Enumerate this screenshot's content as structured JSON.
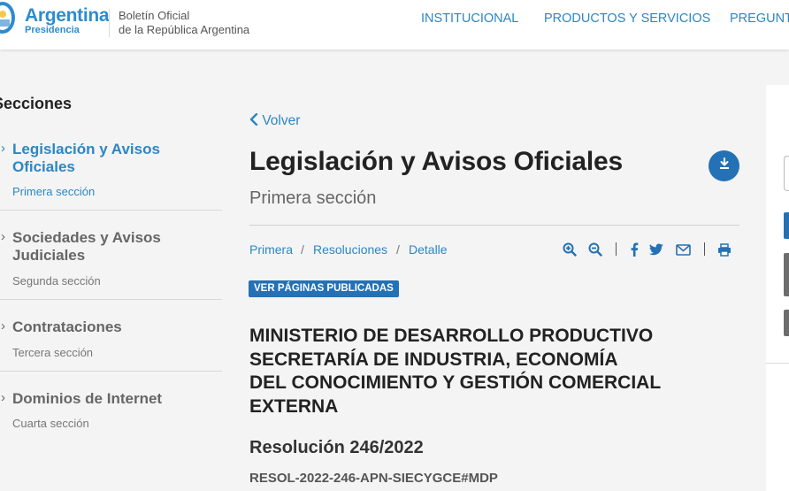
{
  "header": {
    "brand": {
      "name": "Argentina",
      "sub": "Presidencia"
    },
    "boletin": {
      "line1": "Boletín Oficial",
      "line2": "de la República Argentina"
    },
    "nav": [
      "INSTITUCIONAL",
      "PRODUCTOS Y SERVICIOS",
      "PREGUNT"
    ]
  },
  "sidebar": {
    "title": "Secciones",
    "sections": [
      {
        "label": "Legislación y Avisos Oficiales",
        "sub": "Primera sección",
        "active": true
      },
      {
        "label": "Sociedades y Avisos Judiciales",
        "sub": "Segunda sección",
        "active": false
      },
      {
        "label": "Contrataciones",
        "sub": "Tercera sección",
        "active": false
      },
      {
        "label": "Dominios de Internet",
        "sub": "Cuarta sección",
        "active": false
      }
    ]
  },
  "main": {
    "back_label": "Volver",
    "title": "Legislación y Avisos Oficiales",
    "subtitle": "Primera sección",
    "breadcrumb": [
      "Primera",
      "Resoluciones",
      "Detalle"
    ],
    "badge": "VER PÁGINAS PUBLICADAS",
    "organization": [
      "MINISTERIO DE DESARROLLO PRODUCTIVO",
      "SECRETARÍA DE INDUSTRIA, ECONOMÍA",
      "DEL CONOCIMIENTO Y GESTIÓN COMERCIAL",
      "EXTERNA"
    ],
    "resolution_title": "Resolución 246/2022",
    "resolution_code": "RESOL-2022-246-APN-SIECYGCE#MDP"
  },
  "icons": {
    "download": "download-icon",
    "zoom_in": "zoom-in-icon",
    "zoom_out": "zoom-out-icon",
    "facebook": "facebook-icon",
    "twitter": "twitter-icon",
    "email": "email-icon",
    "print": "print-icon"
  },
  "colors": {
    "brand_blue": "#2d8ccf",
    "link_blue": "#2d86c4",
    "button_blue": "#2471b5",
    "background": "#f4f4f4"
  }
}
